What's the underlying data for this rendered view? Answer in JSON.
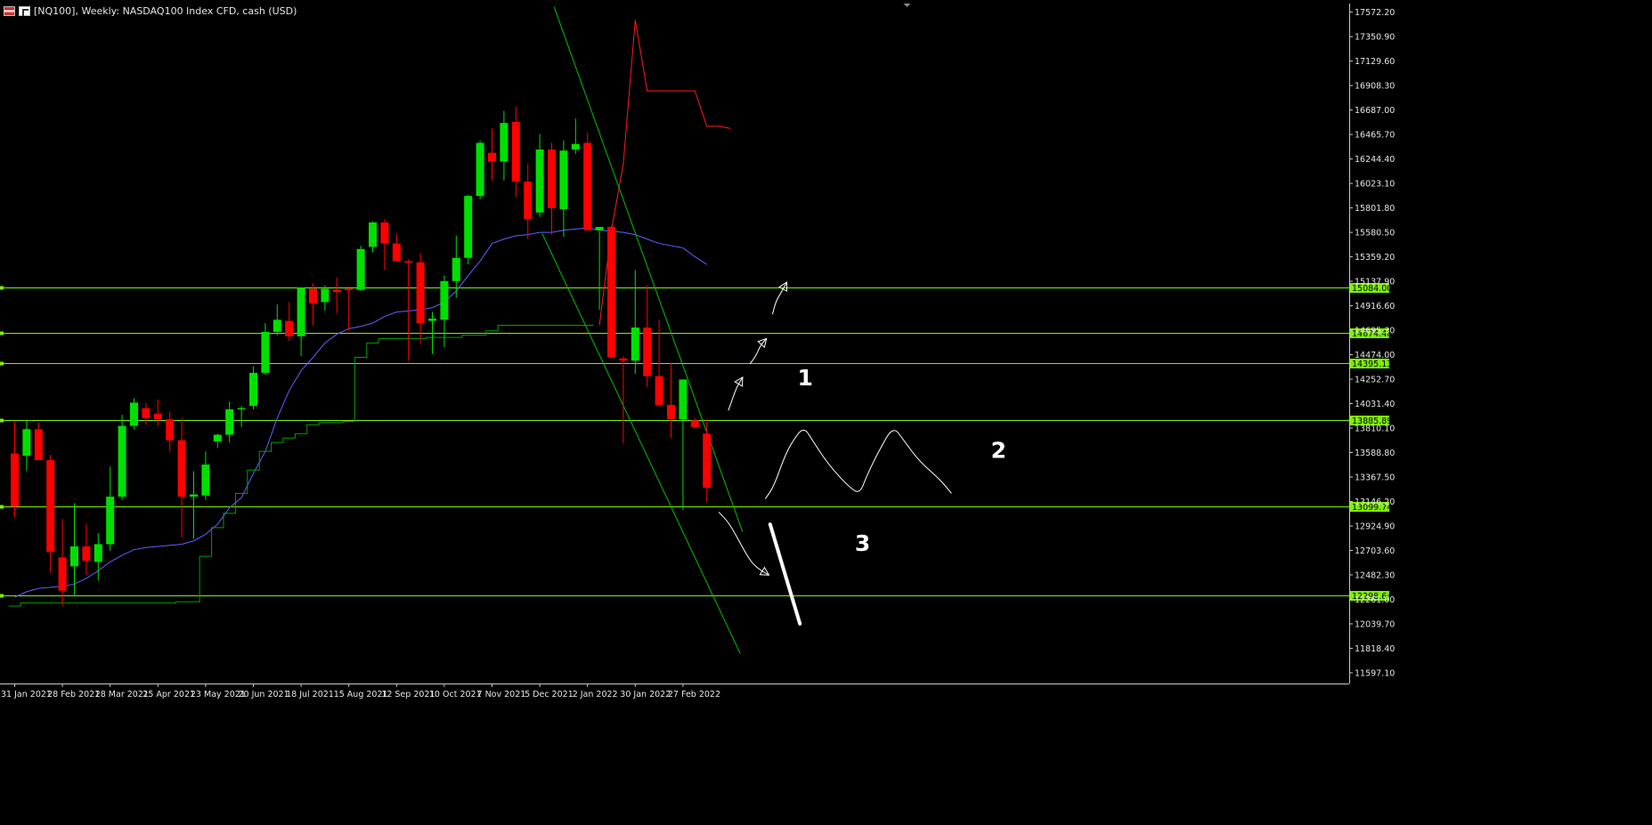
{
  "window": {
    "title": "[NQ100], Weekly:  NASDAQ100 Index CFD, cash (USD)",
    "icons": [
      "chart-type-icon",
      "toolbar-icon"
    ]
  },
  "chart_data": {
    "type": "candlestick",
    "title": "[NQ100], Weekly:  NASDAQ100 Index CFD, cash (USD)",
    "colors": {
      "background": "#000000",
      "bull": "#00e000",
      "bear": "#ff0000",
      "text": "#e6e6e6",
      "axis": "#c8c8c8",
      "level": "#7ff000",
      "level_label_bg": "#7ff000",
      "trend": "#00c000",
      "ma_blue": "#6060ff",
      "ma_green": "#00a000",
      "ma_red": "#ff1a1a",
      "drawing": "#ffffff"
    },
    "y_axis": {
      "ticks": [
        "17572.20",
        "17350.90",
        "17129.60",
        "16908.30",
        "16687.00",
        "16465.70",
        "16244.40",
        "16023.10",
        "15801.80",
        "15580.50",
        "15359.20",
        "15137.90",
        "14916.60",
        "14695.30",
        "14474.00",
        "14252.70",
        "14031.40",
        "13810.10",
        "13588.80",
        "13367.50",
        "13146.20",
        "12924.90",
        "12703.60",
        "12482.30",
        "12261.00",
        "12039.70",
        "11818.40",
        "11597.10"
      ],
      "range": [
        11500,
        17650
      ]
    },
    "x_axis": {
      "ticks": [
        "31 Jan 2021",
        "28 Feb 2021",
        "28 Mar 2021",
        "25 Apr 2021",
        "23 May 2021",
        "20 Jun 2021",
        "18 Jul 2021",
        "15 Aug 2021",
        "12 Sep 2021",
        "10 Oct 2021",
        "7 Nov 2021",
        "5 Dec 2021",
        "2 Jan 2022",
        "30 Jan 2022",
        "27 Feb 2022"
      ],
      "tick_bar_index": [
        0,
        4,
        8,
        12,
        16,
        20,
        24,
        28,
        32,
        36,
        40,
        44,
        48,
        52,
        56
      ]
    },
    "candles": [
      {
        "o": 13580,
        "h": 13870,
        "l": 13000,
        "c": 13100
      },
      {
        "o": 13560,
        "h": 13880,
        "l": 13420,
        "c": 13800
      },
      {
        "o": 13800,
        "h": 13860,
        "l": 13520,
        "c": 13520
      },
      {
        "o": 13520,
        "h": 13570,
        "l": 12500,
        "c": 12690
      },
      {
        "o": 12640,
        "h": 12990,
        "l": 12200,
        "c": 12340
      },
      {
        "o": 12560,
        "h": 13130,
        "l": 12300,
        "c": 12740
      },
      {
        "o": 12740,
        "h": 12940,
        "l": 12480,
        "c": 12610
      },
      {
        "o": 12600,
        "h": 12860,
        "l": 12430,
        "c": 12760
      },
      {
        "o": 12760,
        "h": 13460,
        "l": 12700,
        "c": 13190
      },
      {
        "o": 13190,
        "h": 13930,
        "l": 13160,
        "c": 13830
      },
      {
        "o": 13830,
        "h": 14080,
        "l": 13800,
        "c": 14040
      },
      {
        "o": 13990,
        "h": 14040,
        "l": 13840,
        "c": 13900
      },
      {
        "o": 13940,
        "h": 14070,
        "l": 13830,
        "c": 13890
      },
      {
        "o": 13890,
        "h": 13960,
        "l": 13600,
        "c": 13700
      },
      {
        "o": 13700,
        "h": 13900,
        "l": 12820,
        "c": 13190
      },
      {
        "o": 13190,
        "h": 13420,
        "l": 12810,
        "c": 13210
      },
      {
        "o": 13200,
        "h": 13600,
        "l": 13160,
        "c": 13480
      },
      {
        "o": 13690,
        "h": 13760,
        "l": 13630,
        "c": 13750
      },
      {
        "o": 13750,
        "h": 14050,
        "l": 13680,
        "c": 13980
      },
      {
        "o": 13980,
        "h": 14010,
        "l": 13820,
        "c": 13990
      },
      {
        "o": 14010,
        "h": 14370,
        "l": 13980,
        "c": 14310
      },
      {
        "o": 14310,
        "h": 14760,
        "l": 14290,
        "c": 14680
      },
      {
        "o": 14680,
        "h": 14930,
        "l": 14650,
        "c": 14790
      },
      {
        "o": 14780,
        "h": 14950,
        "l": 14600,
        "c": 14640
      },
      {
        "o": 14640,
        "h": 15080,
        "l": 14460,
        "c": 15080
      },
      {
        "o": 15070,
        "h": 15120,
        "l": 14740,
        "c": 14940
      },
      {
        "o": 14950,
        "h": 15100,
        "l": 14870,
        "c": 15070
      },
      {
        "o": 15060,
        "h": 15170,
        "l": 14850,
        "c": 15040
      },
      {
        "o": 15070,
        "h": 15090,
        "l": 14690,
        "c": 15060
      },
      {
        "o": 15060,
        "h": 15460,
        "l": 15050,
        "c": 15430
      },
      {
        "o": 15450,
        "h": 15680,
        "l": 15400,
        "c": 15670
      },
      {
        "o": 15670,
        "h": 15700,
        "l": 15240,
        "c": 15480
      },
      {
        "o": 15480,
        "h": 15570,
        "l": 15320,
        "c": 15320
      },
      {
        "o": 15320,
        "h": 15340,
        "l": 14420,
        "c": 15310
      },
      {
        "o": 15310,
        "h": 15390,
        "l": 14570,
        "c": 14760
      },
      {
        "o": 14780,
        "h": 14860,
        "l": 14480,
        "c": 14800
      },
      {
        "o": 14790,
        "h": 15190,
        "l": 14540,
        "c": 15140
      },
      {
        "o": 15140,
        "h": 15550,
        "l": 14990,
        "c": 15350
      },
      {
        "o": 15350,
        "h": 15920,
        "l": 15290,
        "c": 15910
      },
      {
        "o": 15910,
        "h": 16410,
        "l": 15880,
        "c": 16390
      },
      {
        "o": 16300,
        "h": 16520,
        "l": 16050,
        "c": 16220
      },
      {
        "o": 16220,
        "h": 16680,
        "l": 16050,
        "c": 16570
      },
      {
        "o": 16580,
        "h": 16720,
        "l": 15900,
        "c": 16040
      },
      {
        "o": 16040,
        "h": 16200,
        "l": 15520,
        "c": 15700
      },
      {
        "o": 15760,
        "h": 16470,
        "l": 15720,
        "c": 16330
      },
      {
        "o": 16330,
        "h": 16390,
        "l": 15560,
        "c": 15800
      },
      {
        "o": 15790,
        "h": 16410,
        "l": 15540,
        "c": 16320
      },
      {
        "o": 16330,
        "h": 16610,
        "l": 16290,
        "c": 16380
      },
      {
        "o": 16390,
        "h": 16480,
        "l": 15600,
        "c": 15600
      },
      {
        "o": 15600,
        "h": 15620,
        "l": 14880,
        "c": 15630
      },
      {
        "o": 15630,
        "h": 15640,
        "l": 14440,
        "c": 14450
      },
      {
        "o": 14440,
        "h": 14460,
        "l": 13670,
        "c": 14420
      },
      {
        "o": 14420,
        "h": 15240,
        "l": 14300,
        "c": 14720
      },
      {
        "o": 14720,
        "h": 15100,
        "l": 14180,
        "c": 14280
      },
      {
        "o": 14280,
        "h": 14790,
        "l": 14010,
        "c": 14020
      },
      {
        "o": 14020,
        "h": 14400,
        "l": 13720,
        "c": 13890
      },
      {
        "o": 13890,
        "h": 13930,
        "l": 13070,
        "c": 14250
      },
      {
        "o": 13880,
        "h": 13900,
        "l": 13820,
        "c": 13820
      },
      {
        "o": 13760,
        "h": 13890,
        "l": 13140,
        "c": 13270
      }
    ],
    "series": [
      {
        "style": "blue",
        "values": [
          12280,
          12330,
          12360,
          12370,
          12380,
          12400,
          12450,
          12520,
          12600,
          12660,
          12710,
          12730,
          12740,
          12750,
          12760,
          12790,
          12850,
          12940,
          13090,
          13180,
          13400,
          13600,
          13900,
          14150,
          14330,
          14450,
          14580,
          14660,
          14710,
          14730,
          14760,
          14820,
          14860,
          14870,
          14880,
          14900,
          14950,
          15050,
          15190,
          15320,
          15480,
          15520,
          15550,
          15560,
          15580,
          15580,
          15600,
          15610,
          15620,
          15600,
          15590,
          15580,
          15560,
          15520,
          15480,
          15460,
          15440,
          15360,
          15290
        ]
      },
      {
        "style": "green",
        "values": [
          12200,
          12230,
          12230,
          12230,
          12230,
          12230,
          12230,
          12230,
          12230,
          12230,
          12230,
          12230,
          12230,
          12230,
          12240,
          12240,
          12650,
          12910,
          13040,
          13220,
          13430,
          13600,
          13680,
          13720,
          13760,
          13840,
          13860,
          13860,
          13870,
          14450,
          14580,
          14620,
          14620,
          14620,
          14620,
          14630,
          14630,
          14630,
          14650,
          14650,
          14690,
          14740,
          14740,
          14740,
          14740,
          14740,
          14740,
          14740,
          14740,
          14740
        ]
      },
      {
        "style": "red",
        "values": [
          14740,
          15600,
          16200,
          17500,
          16860,
          16860,
          16860,
          16860,
          16860,
          16540,
          16540,
          16520
        ]
      }
    ],
    "red_start_index": 49,
    "levels": [
      {
        "price": 15084.0,
        "label": "15084.00"
      },
      {
        "price": 14674.48,
        "label": "14674.48"
      },
      {
        "price": 14395.13,
        "label": "14395.13"
      },
      {
        "price": 13885.89,
        "label": "13885.89"
      },
      {
        "price": 13099.74,
        "label": "13099.74"
      },
      {
        "price": 12298.64,
        "label": "12298.64"
      }
    ],
    "trendlines": [
      {
        "from": {
          "bar": 45.2,
          "price": 17620
        },
        "to": {
          "bar": 61.0,
          "price": 12870
        }
      },
      {
        "from": {
          "bar": 44.2,
          "price": 15570
        },
        "to": {
          "bar": 60.8,
          "price": 11770
        }
      }
    ],
    "annotations": [
      {
        "text": "1",
        "bar": 65.6,
        "price": 14195
      },
      {
        "text": "2",
        "bar": 81.8,
        "price": 13540
      },
      {
        "text": "3",
        "bar": 70.4,
        "price": 12700
      }
    ],
    "drawings": [
      {
        "kind": "curve",
        "pts": [
          [
            59.8,
            13970
          ],
          [
            60.2,
            14090
          ],
          [
            60.5,
            14180
          ],
          [
            61.0,
            14270
          ]
        ],
        "arrow": true
      },
      {
        "kind": "curve",
        "pts": [
          [
            61.6,
            14390
          ],
          [
            62.1,
            14460
          ],
          [
            62.5,
            14560
          ],
          [
            63.0,
            14620
          ]
        ],
        "arrow": true
      },
      {
        "kind": "curve",
        "pts": [
          [
            63.5,
            14840
          ],
          [
            63.8,
            14960
          ],
          [
            64.2,
            15030
          ],
          [
            64.7,
            15130
          ]
        ],
        "arrow": true
      },
      {
        "kind": "curve",
        "pts": [
          [
            62.9,
            13170
          ],
          [
            63.6,
            13280
          ],
          [
            64.4,
            13520
          ],
          [
            65.0,
            13660
          ],
          [
            66.1,
            13830
          ],
          [
            66.9,
            13690
          ],
          [
            68.2,
            13480
          ],
          [
            69.8,
            13290
          ],
          [
            70.8,
            13210
          ],
          [
            71.4,
            13380
          ],
          [
            72.4,
            13600
          ],
          [
            73.6,
            13830
          ],
          [
            74.5,
            13700
          ],
          [
            75.8,
            13510
          ],
          [
            77.5,
            13350
          ],
          [
            78.5,
            13220
          ]
        ],
        "arrow": false
      },
      {
        "kind": "curve",
        "pts": [
          [
            59.0,
            13050
          ],
          [
            59.8,
            12960
          ],
          [
            60.5,
            12830
          ],
          [
            61.3,
            12670
          ],
          [
            62.0,
            12560
          ],
          [
            63.2,
            12480
          ]
        ],
        "arrow": true
      },
      {
        "kind": "thick",
        "pts": [
          [
            63.3,
            12940
          ],
          [
            65.8,
            12040
          ]
        ]
      }
    ]
  }
}
